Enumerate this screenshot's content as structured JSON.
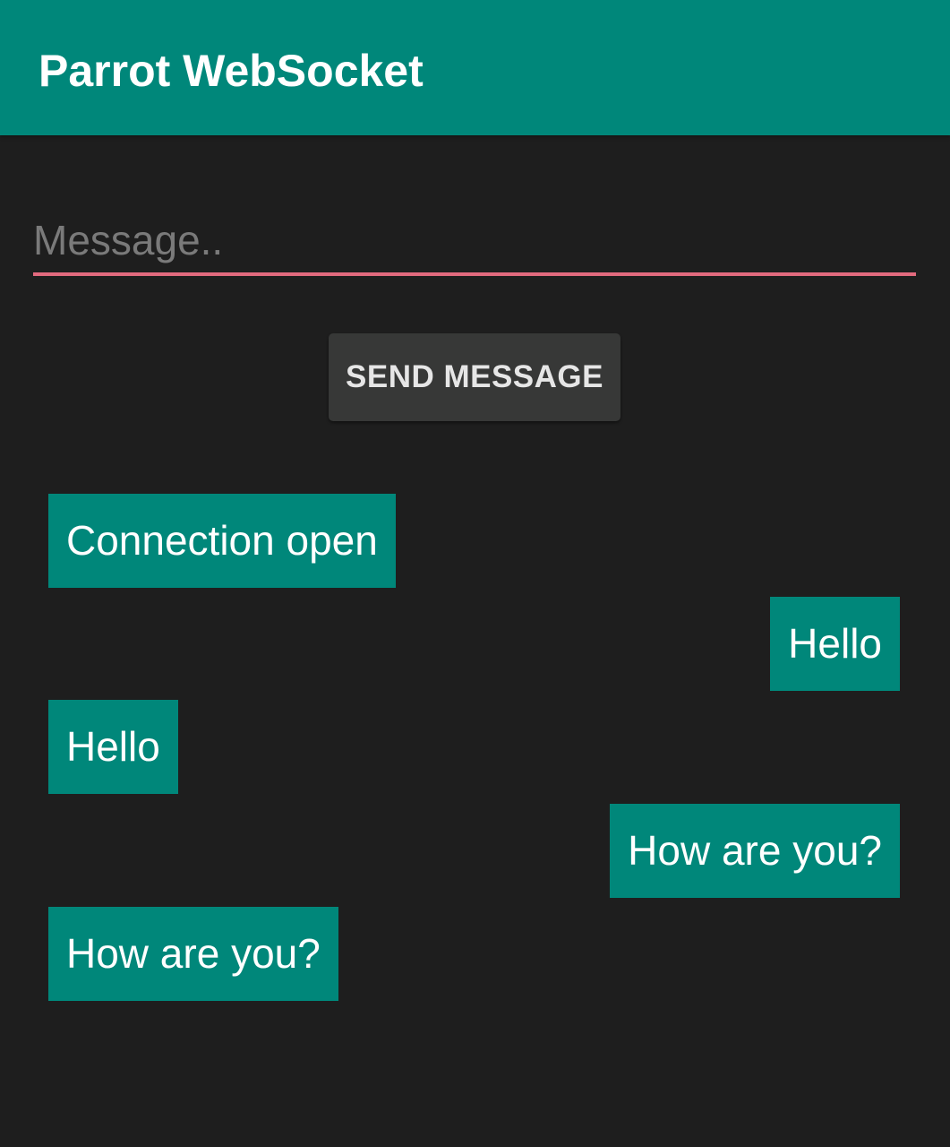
{
  "app": {
    "title": "Parrot WebSocket"
  },
  "composer": {
    "placeholder": "Message..",
    "value": "",
    "send_label": "SEND MESSAGE"
  },
  "messages": [
    {
      "text": "Connection open",
      "side": "left"
    },
    {
      "text": "Hello",
      "side": "right"
    },
    {
      "text": "Hello",
      "side": "left"
    },
    {
      "text": "How are you?",
      "side": "right"
    },
    {
      "text": "How are you?",
      "side": "left"
    }
  ],
  "colors": {
    "primary": "#00877a",
    "background": "#1e1e1e",
    "input_underline": "#e26a7e",
    "button_background": "#373837"
  }
}
